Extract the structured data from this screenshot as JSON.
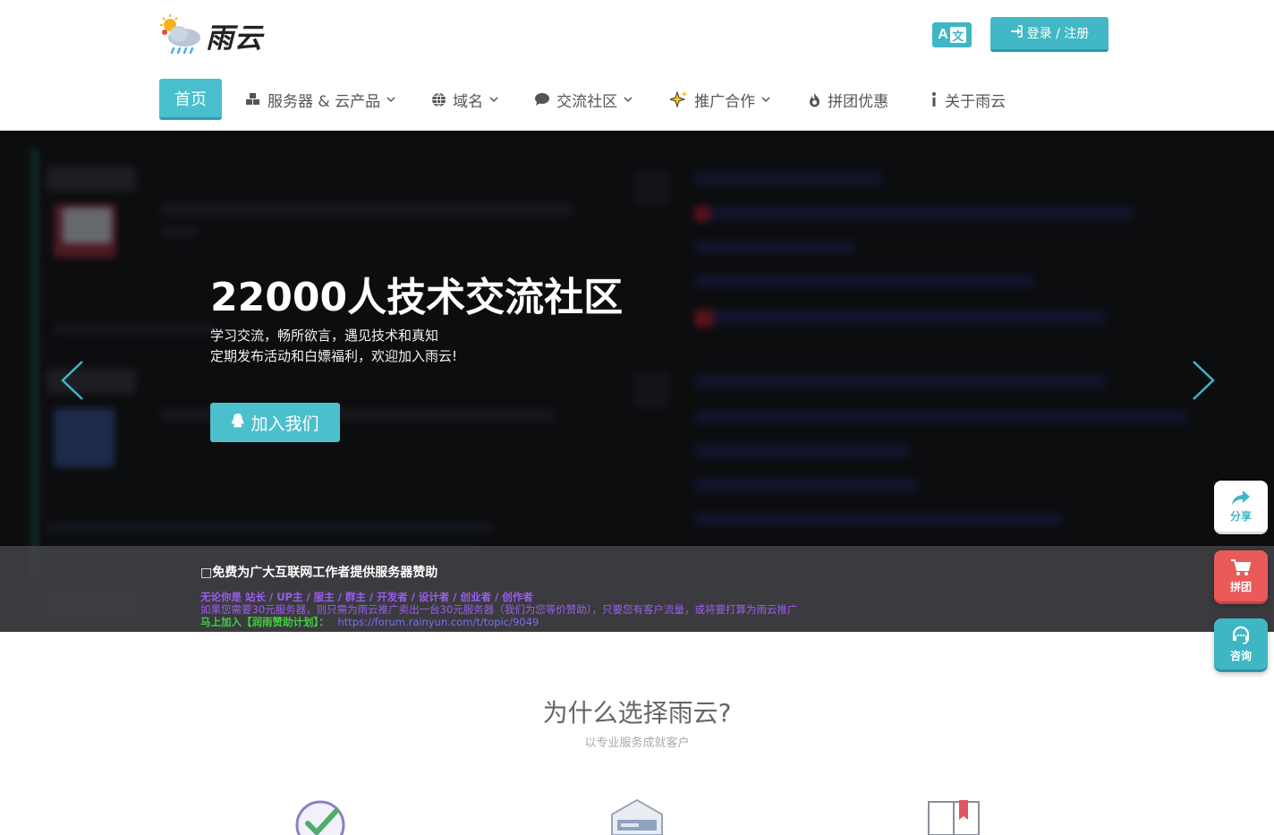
{
  "header": {
    "logo_text": "雨云",
    "lang_a": "A",
    "lang_zh": "文",
    "login_label": "登录 / 注册"
  },
  "nav": {
    "items": [
      {
        "label": "首页",
        "icon": "",
        "dropdown": false
      },
      {
        "label": "服务器 & 云产品",
        "icon": "cubes-icon",
        "dropdown": true
      },
      {
        "label": "域名",
        "icon": "globe-icon",
        "dropdown": true
      },
      {
        "label": "交流社区",
        "icon": "chat-bubble-icon",
        "dropdown": true
      },
      {
        "label": "推广合作",
        "icon": "sparkle-icon",
        "dropdown": true
      },
      {
        "label": "拼团优惠",
        "icon": "fire-icon",
        "dropdown": false
      },
      {
        "label": "关于雨云",
        "icon": "info-icon",
        "dropdown": false
      }
    ]
  },
  "hero": {
    "title": "22000人技术交流社区",
    "line1": "学习交流，畅所欲言，遇见技术和真知",
    "line2": "定期发布活动和白嫖福利，欢迎加入雨云!",
    "join_label": "加入我们"
  },
  "banner": {
    "title": "□免费为广大互联网工作者提供服务器赞助",
    "line1": "无论你是 站长 / UP主 / 服主 / 群主 / 开发者 / 设计者 / 创业者 / 创作者",
    "line2_a": "如果您需要30元服务器，则只需为雨云推广卖出一台30元服务器（我们为您等价赞助），只要您有客户流量，或将要打算为雨云推广",
    "line3_a": "马上加入【润雨赞助计划】：",
    "line3_link": "https://forum.rainyun.com/t/topic/9049"
  },
  "floating": {
    "share": "分享",
    "group": "拼团",
    "consult": "咨询"
  },
  "why": {
    "title": "为什么选择雨云?",
    "subtitle": "以专业服务成就客户"
  },
  "colors": {
    "accent": "#49bfcd",
    "red": "#ea5a5a",
    "banner_purple": "#9b5cf0",
    "banner_green": "#3fcf3f"
  }
}
